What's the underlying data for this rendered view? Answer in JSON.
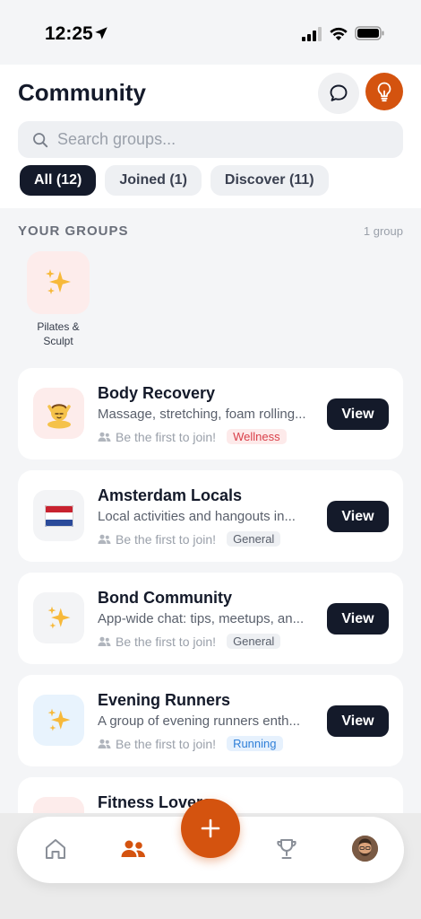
{
  "status": {
    "time": "12:25"
  },
  "header": {
    "title": "Community",
    "search_placeholder": "Search groups...",
    "tabs": [
      {
        "label": "All (12)",
        "active": true
      },
      {
        "label": "Joined (1)",
        "active": false
      },
      {
        "label": "Discover (11)",
        "active": false
      }
    ]
  },
  "your_groups": {
    "title": "YOUR GROUPS",
    "count": "1 group",
    "items": [
      {
        "label": "Pilates & Sculpt",
        "icon": "sparkles-icon"
      }
    ]
  },
  "groups": [
    {
      "title": "Body Recovery",
      "desc": "Massage, stretching, foam rolling...",
      "meta": "Be the first to join!",
      "tag": "Wellness",
      "icon": "massage-icon",
      "button": "View"
    },
    {
      "title": "Amsterdam Locals",
      "desc": "Local activities and hangouts in...",
      "meta": "Be the first to join!",
      "tag": "General",
      "icon": "netherlands-flag-icon",
      "button": "View"
    },
    {
      "title": "Bond Community",
      "desc": "App-wide chat: tips, meetups, an...",
      "meta": "Be the first to join!",
      "tag": "General",
      "icon": "sparkles-icon",
      "button": "View"
    },
    {
      "title": "Evening Runners",
      "desc": "A group of evening runners enth...",
      "meta": "Be the first to join!",
      "tag": "Running",
      "icon": "sparkles-icon",
      "button": "View"
    },
    {
      "title": "Fitness Lovers",
      "icon": "flexed-biceps-icon"
    }
  ],
  "colors": {
    "accent": "#d4530f",
    "dark": "#141a2a",
    "wellness_tag_bg": "#fdeaea",
    "wellness_tag_text": "#d9404a",
    "general_tag_bg": "#eef0f3",
    "general_tag_text": "#5a606c",
    "running_tag_bg": "#e6f1fd",
    "running_tag_text": "#2f7fd8"
  },
  "bottom_nav": {
    "items": [
      "home-icon",
      "community-icon",
      "add-icon",
      "trophy-icon",
      "profile-avatar"
    ],
    "active": "community-icon"
  }
}
